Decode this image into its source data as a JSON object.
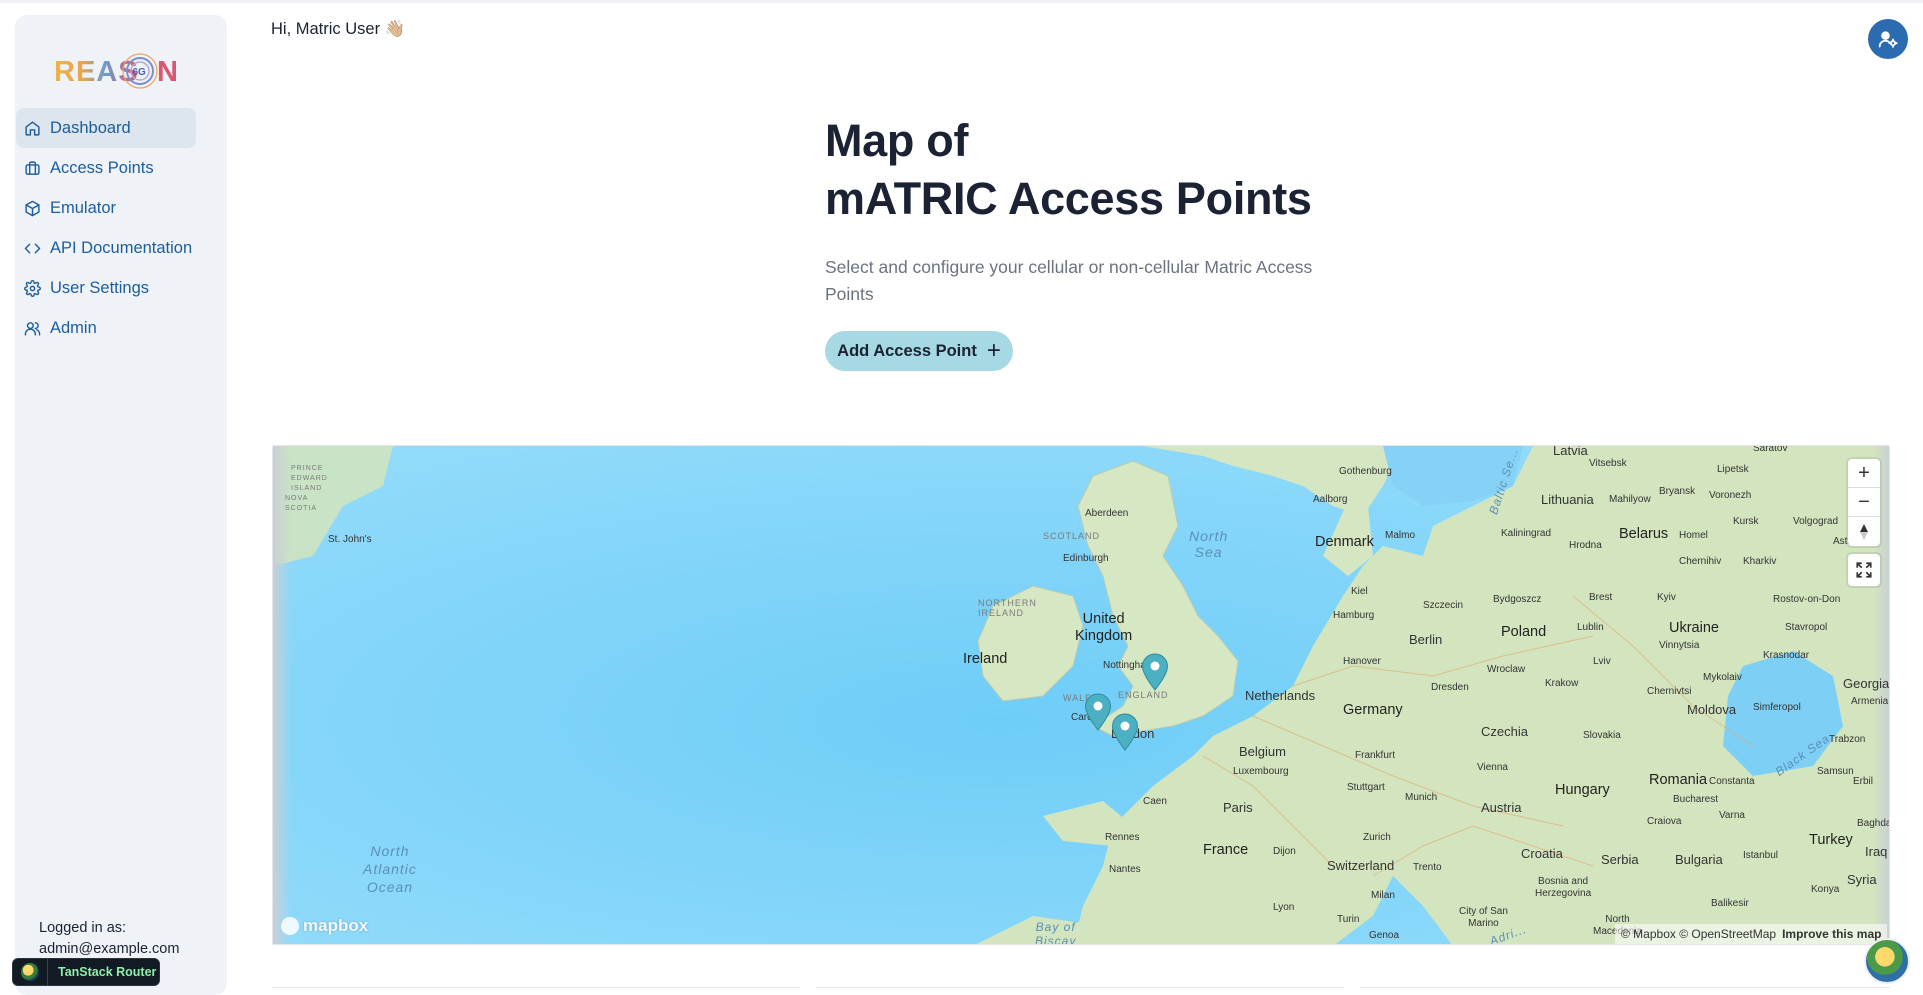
{
  "app": {
    "logo_text": "REASON",
    "logo_badge": "6G"
  },
  "sidebar": {
    "items": [
      {
        "label": "Dashboard",
        "icon": "home-icon",
        "active": true
      },
      {
        "label": "Access Points",
        "icon": "briefcase-icon",
        "active": false
      },
      {
        "label": "Emulator",
        "icon": "cube-icon",
        "active": false
      },
      {
        "label": "API Documentation",
        "icon": "code-icon",
        "active": false
      },
      {
        "label": "User Settings",
        "icon": "gear-icon",
        "active": false
      },
      {
        "label": "Admin",
        "icon": "users-icon",
        "active": false
      }
    ],
    "logged_in_label": "Logged in as:",
    "logged_in_email": "admin@example.com"
  },
  "devtools": {
    "label": "TanStack Router"
  },
  "header": {
    "greeting": "Hi, Matric User 👋🏼",
    "user_button_icon": "user-gear-icon"
  },
  "hero": {
    "title_line1": "Map of",
    "title_line2": "mATRIC Access Points",
    "subtitle": "Select and configure your cellular or non-cellular Matric Access Points",
    "add_button": "Add Access Point",
    "add_icon": "+"
  },
  "map": {
    "controls": {
      "zoom_in": "+",
      "zoom_out": "−",
      "compass": "compass-icon",
      "fullscreen": "fullscreen-icon"
    },
    "logo": "mapbox",
    "attribution": "© Mapbox © OpenStreetMap",
    "improve": "Improve this map",
    "labels": {
      "latvia": "Latvia",
      "gothenburg": "Gothenburg",
      "vitsebsk": "Vitsebsk",
      "saratov": "Saratov",
      "lipetsk": "Lipetsk",
      "lithuania": "Lithuania",
      "mahilyow": "Mahilyow",
      "bryansk": "Bryansk",
      "voronezh": "Voronezh",
      "aberdeen": "Aberdeen",
      "aalborg": "Aalborg",
      "kaliningrad": "Kaliningrad",
      "scotland": "SCOTLAND",
      "north_sea": "North\nSea",
      "denmark": "Denmark",
      "malmo": "Malmo",
      "hrodna": "Hrodna",
      "belarus": "Belarus",
      "homel": "Homel",
      "kursk": "Kursk",
      "volgograd": "Volgograd",
      "astrakhan": "Astrakhan",
      "edinburgh": "Edinburgh",
      "chernihiv": "Chernihiv",
      "kharkiv": "Kharkiv",
      "st_johns": "St. John's",
      "northern_ireland": "NORTHERN\nIRELAND",
      "kiel": "Kiel",
      "szczecin": "Szczecin",
      "bydgoszcz": "Bydgoszcz",
      "brest": "Brest",
      "kyiv": "Kyiv",
      "rostov": "Rostov-on-Don",
      "uk": "United\nKingdom",
      "hamburg": "Hamburg",
      "berlin": "Berlin",
      "poland": "Poland",
      "lublin": "Lublin",
      "ukraine": "Ukraine",
      "stavropol": "Stavropol",
      "vinnytsia": "Vinnytsia",
      "ireland": "Ireland",
      "nottingham": "Nottingham",
      "hanover": "Hanover",
      "wroclaw": "Wroclaw",
      "lviv": "Lviv",
      "krasnodar": "Krasnodar",
      "mykolaiv": "Mykolaiv",
      "georgia": "Georgia",
      "wales": "WALES",
      "england": "ENGLAND",
      "netherlands": "Netherlands",
      "dresden": "Dresden",
      "krakow": "Krakow",
      "chernivtsi": "Chernivtsi",
      "armenia": "Armenia",
      "cardiff": "Cardiff",
      "germany": "Germany",
      "moldova": "Moldova",
      "simferopol": "Simferopol",
      "london": "London",
      "czechia": "Czechia",
      "slovakia": "Slovakia",
      "trabzon": "Trabzon",
      "belgium": "Belgium",
      "frankfurt": "Frankfurt",
      "black_sea": "Black Sea",
      "luxembourg": "Luxembourg",
      "vienna": "Vienna",
      "samsun": "Samsun",
      "stuttgart": "Stuttgart",
      "hungary": "Hungary",
      "romania": "Romania",
      "constanta": "Constanta",
      "erbil": "Erbil",
      "caen": "Caen",
      "munich": "Munich",
      "paris": "Paris",
      "austria": "Austria",
      "bucharest": "Bucharest",
      "craiova": "Craiova",
      "varna": "Varna",
      "baghdad": "Baghdad",
      "rennes": "Rennes",
      "zurich": "Zurich",
      "turkey": "Turkey",
      "iraq": "Iraq",
      "france": "France",
      "dijon": "Dijon",
      "croatia": "Croatia",
      "serbia": "Serbia",
      "bulgaria": "Bulgaria",
      "istanbul": "Istanbul",
      "switzerland": "Switzerland",
      "trento": "Trento",
      "nantes": "Nantes",
      "bosnia": "Bosnia and\nHerzegovina",
      "konya": "Konya",
      "syria": "Syria",
      "lyon": "Lyon",
      "milan": "Milan",
      "city_of_san_marino": "City of San\nMarino",
      "north_macedonia": "North\nMacedonia",
      "balikesir": "Balikesir",
      "turin": "Turin",
      "genoa": "Genoa",
      "bay_of_biscay": "Bay of\nBiscay",
      "adriatic": "Adri...",
      "north_atlantic": "North\nAtlantic\nOcean",
      "prince_edward": "PRINCE\nEDWARD\nISLAND",
      "nova_scotia": "NOVA\nSCOTIA",
      "baltic": "Baltic Se..."
    }
  }
}
